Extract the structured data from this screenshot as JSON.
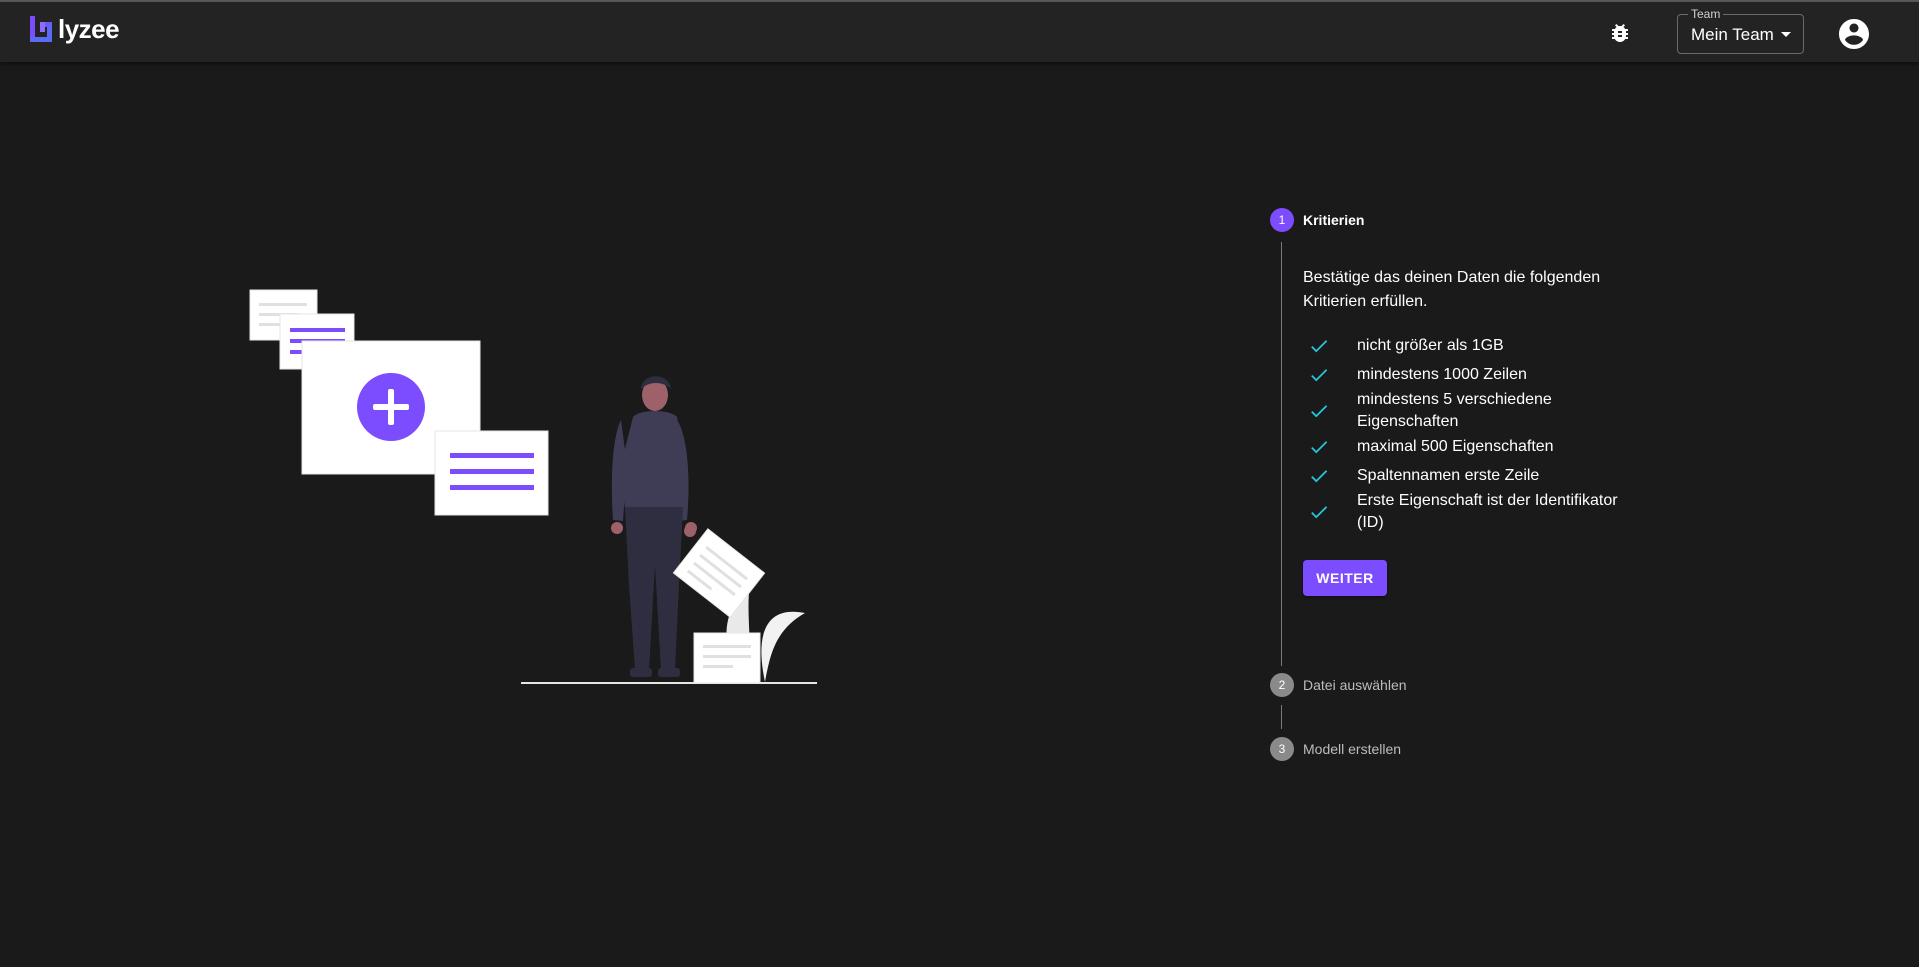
{
  "app": {
    "logo_text": "lyzee"
  },
  "header": {
    "team_label": "Team",
    "team_value": "Mein Team"
  },
  "stepper": {
    "steps": [
      {
        "number": "1",
        "label": "Kritierien"
      },
      {
        "number": "2",
        "label": "Datei auswählen"
      },
      {
        "number": "3",
        "label": "Modell erstellen"
      }
    ],
    "intro": "Bestätige das deinen Daten die folgenden Kritierien erfüllen.",
    "criteria": [
      "nicht größer als 1GB",
      "mindestens 1000 Zeilen",
      "mindestens 5 verschiedene Eigenschaften",
      "maximal 500 Eigenschaften",
      "Spaltennamen erste Zeile",
      "Erste Eigenschaft ist der Identifikator (ID)"
    ],
    "next_button": "WEITER"
  },
  "colors": {
    "accent": "#7c4dff",
    "check": "#26c6da",
    "background": "#1a1a1a",
    "appbar": "#232323"
  }
}
